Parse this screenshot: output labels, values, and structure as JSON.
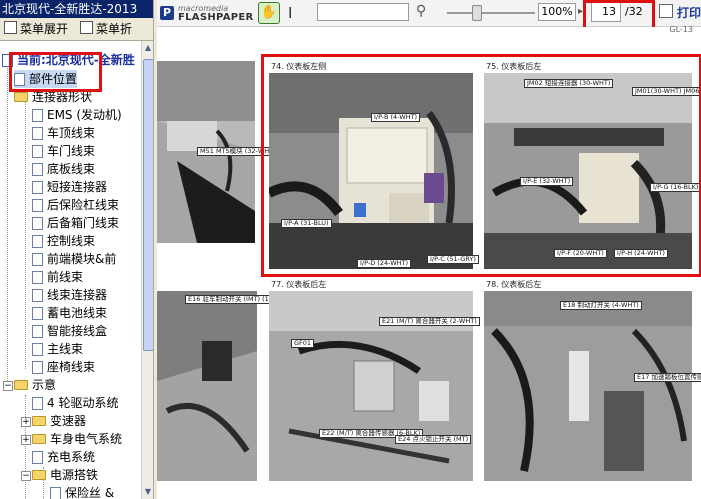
{
  "window": {
    "title": "北京现代-全新胜达-2013"
  },
  "menubar": {
    "expand_label": "菜单展开",
    "collapse_label": "菜单折"
  },
  "tree": {
    "current_label": "当前:北京现代-全新胜",
    "items": [
      {
        "label": "部件位置",
        "type": "doc",
        "level": 1,
        "selected": true
      },
      {
        "label": "连接器形状",
        "type": "folder",
        "level": 1,
        "expanded": true
      },
      {
        "label": "EMS (发动机)",
        "type": "doc",
        "level": 2
      },
      {
        "label": "车顶线束",
        "type": "doc",
        "level": 2
      },
      {
        "label": "车门线束",
        "type": "doc",
        "level": 2
      },
      {
        "label": "底板线束",
        "type": "doc",
        "level": 2
      },
      {
        "label": "短接连接器",
        "type": "doc",
        "level": 2
      },
      {
        "label": "后保险杠线束",
        "type": "doc",
        "level": 2
      },
      {
        "label": "后备箱门线束",
        "type": "doc",
        "level": 2
      },
      {
        "label": "控制线束",
        "type": "doc",
        "level": 2
      },
      {
        "label": "前端模块&前",
        "type": "doc",
        "level": 2
      },
      {
        "label": "前线束",
        "type": "doc",
        "level": 2
      },
      {
        "label": "线束连接器",
        "type": "doc",
        "level": 2
      },
      {
        "label": "蓄电池线束",
        "type": "doc",
        "level": 2
      },
      {
        "label": "智能接线盒",
        "type": "doc",
        "level": 2
      },
      {
        "label": "主线束",
        "type": "doc",
        "level": 2
      },
      {
        "label": "座椅线束",
        "type": "doc",
        "level": 2
      },
      {
        "label": "示意",
        "type": "folder",
        "level": 1,
        "expanded": true
      },
      {
        "label": "4 轮驱动系统",
        "type": "doc",
        "level": 2
      },
      {
        "label": "变速器",
        "type": "folder",
        "level": 2,
        "expanded": false
      },
      {
        "label": "车身电气系统",
        "type": "folder",
        "level": 2,
        "expanded": false
      },
      {
        "label": "充电系统",
        "type": "doc",
        "level": 2
      },
      {
        "label": "电源搭铁",
        "type": "folder",
        "level": 2,
        "expanded": true
      },
      {
        "label": "保险丝 &",
        "type": "doc",
        "level": 3
      }
    ]
  },
  "viewer": {
    "brand_small": "macromedia",
    "brand_big": "FLASHPAPER",
    "search_value": "",
    "zoom": "100%",
    "page_current": "13",
    "page_total": "/32",
    "print_label": "打印",
    "page_header": "GL-13"
  },
  "figures": [
    {
      "title": "74. 仪表板左侧",
      "callouts": [
        "I/P-B (4-WHT)",
        "I/P-A (31-BLU)",
        "I/P-D (24-WHT)",
        "I/P-C (51-GRY)"
      ]
    },
    {
      "title": "75. 仪表板后左",
      "callouts": [
        "JM02 短接连接器 (30-WHT)",
        "JM01(30-WHT) JM06(14-GRY) 短接连接器",
        "I/P-E (32-WHT)",
        "I/P-G (16-BLK)",
        "I/P-F (20-WHT)",
        "I/P-H (24-WHT)"
      ]
    },
    {
      "title": "",
      "callouts": [
        "M51 MTS模块 (32-WHT)"
      ]
    },
    {
      "title": "",
      "callouts": [
        "E16 驻车制动开关 (IMT) (1-WHT)"
      ]
    },
    {
      "title": "77. 仪表板后左",
      "callouts": [
        "GF01",
        "E21 (M/T) 离合器开关 (2-WHT)",
        "E22 (M/T) 离合器传感器 (6-BLK)",
        "E24 点火锁止开关 (MT)"
      ]
    },
    {
      "title": "78. 仪表板后左",
      "callouts": [
        "E18 制动灯开关 (4-WHT)",
        "E17 加速踏板位置传感器 (6-NLK)"
      ]
    }
  ]
}
